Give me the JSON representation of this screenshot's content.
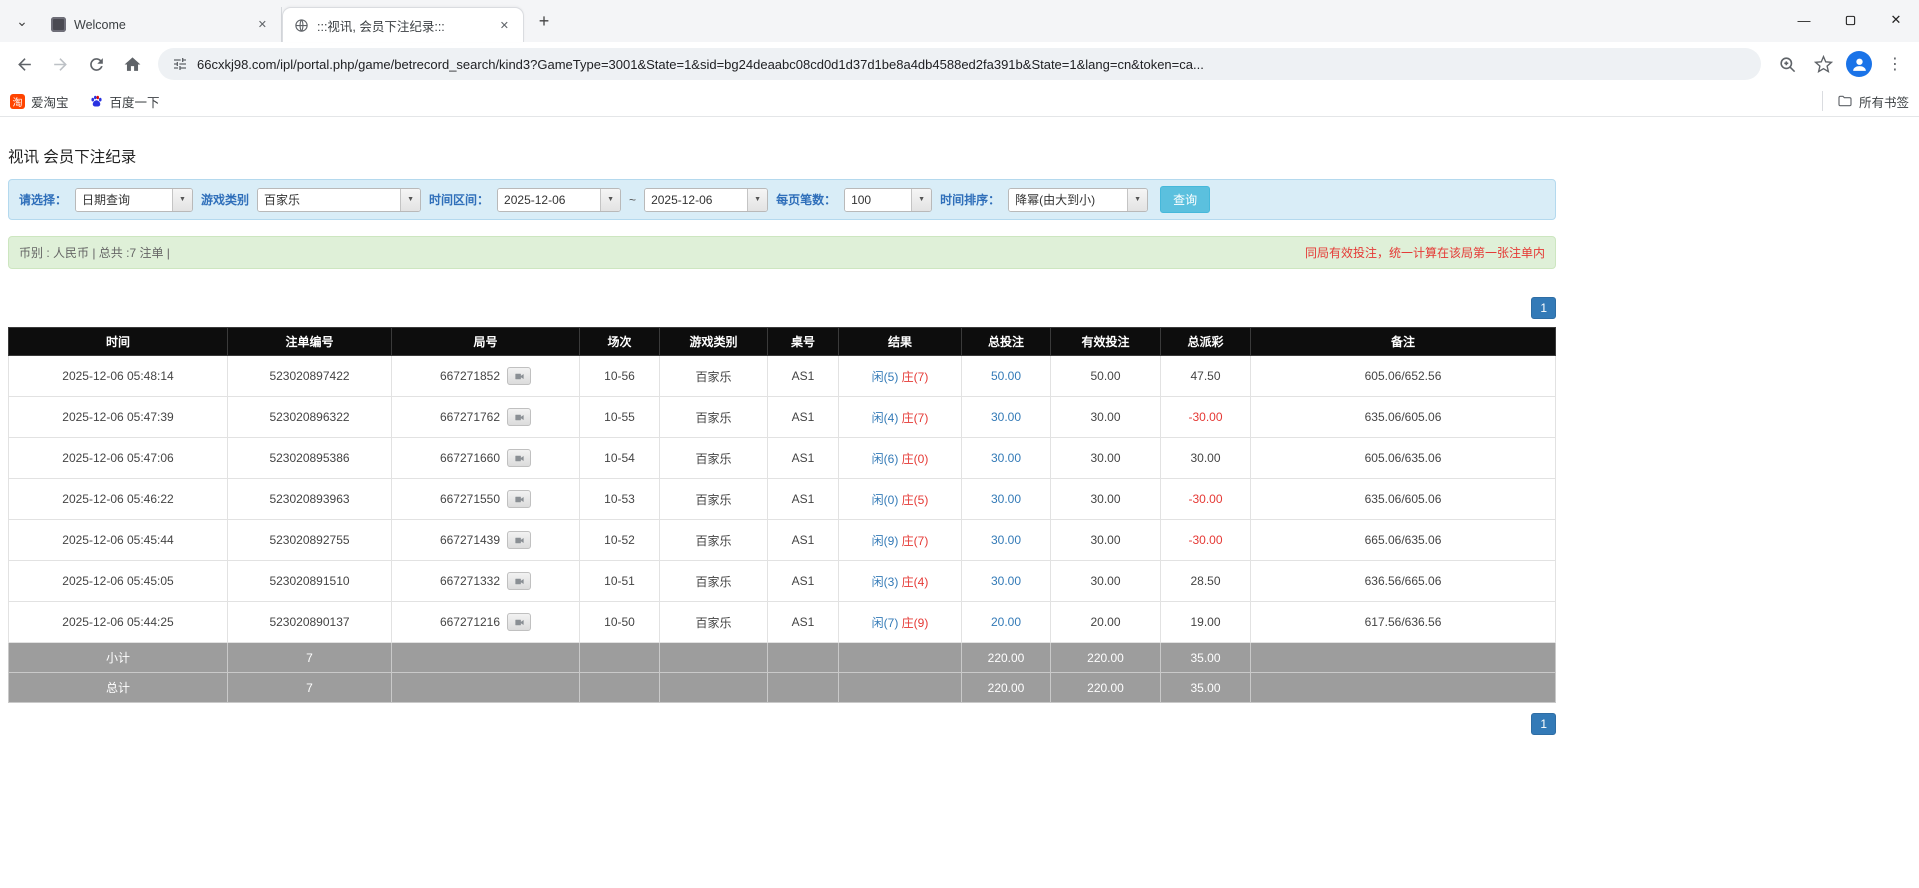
{
  "icons": {
    "tab_search": "⌄",
    "close": "✕",
    "new_tab": "+",
    "minimize": "—",
    "menu": "⋮",
    "dropdown": "▼"
  },
  "colors": {
    "accent_blue": "#337ab7",
    "search_button": "#5bc0de",
    "negative_red": "#e53935",
    "filter_bg": "#d9edf7",
    "summary_bg": "#dff0d8",
    "header_bg": "#0d0d0d",
    "total_row_bg": "#9d9d9d"
  },
  "browser": {
    "tabs": [
      {
        "title": "Welcome"
      },
      {
        "title": ":::视讯, 会员下注纪录:::"
      }
    ],
    "url": "66cxkj98.com/ipl/portal.php/game/betrecord_search/kind3?GameType=3001&State=1&sid=bg24deaabc08cd0d1d37d1be8a4db4588ed2fa391b&State=1&lang=cn&token=ca...",
    "bookmarks": [
      {
        "label": "爱淘宝",
        "icon_text": "淘"
      },
      {
        "label": "百度一下"
      }
    ],
    "all_bookmarks_label": "所有书签"
  },
  "page": {
    "title": "视讯 会员下注纪录",
    "filters": {
      "select_label": "请选择：",
      "select_value": "日期查询",
      "game_type_label": "游戏类别",
      "game_type_value": "百家乐",
      "date_range_label": "时间区间：",
      "date_from": "2025-12-06",
      "tilde": "~",
      "date_to": "2025-12-06",
      "page_size_label": "每页笔数：",
      "page_size_value": "100",
      "sort_label": "时间排序：",
      "sort_value": "降幂(由大到小)",
      "search_button": "查询"
    },
    "summary": {
      "left": "币别 : 人民币 | 总共 :7 注单 |",
      "right": "同局有效投注，统一计算在该局第一张注单内"
    },
    "pagination": "1",
    "table": {
      "headers": [
        "时间",
        "注单编号",
        "局号",
        "场次",
        "游戏类别",
        "桌号",
        "结果",
        "总投注",
        "有效投注",
        "总派彩",
        "备注"
      ],
      "rows": [
        {
          "time": "2025-12-06 05:48:14",
          "bet_id": "523020897422",
          "round_no": "667271852",
          "session": "10-56",
          "game": "百家乐",
          "table_no": "AS1",
          "player": "闲(5)",
          "banker": "庄(7)",
          "total_bet": "50.00",
          "valid_bet": "50.00",
          "payout": "47.50",
          "remark": "605.06/652.56"
        },
        {
          "time": "2025-12-06 05:47:39",
          "bet_id": "523020896322",
          "round_no": "667271762",
          "session": "10-55",
          "game": "百家乐",
          "table_no": "AS1",
          "player": "闲(4)",
          "banker": "庄(7)",
          "total_bet": "30.00",
          "valid_bet": "30.00",
          "payout": "-30.00",
          "remark": "635.06/605.06"
        },
        {
          "time": "2025-12-06 05:47:06",
          "bet_id": "523020895386",
          "round_no": "667271660",
          "session": "10-54",
          "game": "百家乐",
          "table_no": "AS1",
          "player": "闲(6)",
          "banker": "庄(0)",
          "total_bet": "30.00",
          "valid_bet": "30.00",
          "payout": "30.00",
          "remark": "605.06/635.06"
        },
        {
          "time": "2025-12-06 05:46:22",
          "bet_id": "523020893963",
          "round_no": "667271550",
          "session": "10-53",
          "game": "百家乐",
          "table_no": "AS1",
          "player": "闲(0)",
          "banker": "庄(5)",
          "total_bet": "30.00",
          "valid_bet": "30.00",
          "payout": "-30.00",
          "remark": "635.06/605.06"
        },
        {
          "time": "2025-12-06 05:45:44",
          "bet_id": "523020892755",
          "round_no": "667271439",
          "session": "10-52",
          "game": "百家乐",
          "table_no": "AS1",
          "player": "闲(9)",
          "banker": "庄(7)",
          "total_bet": "30.00",
          "valid_bet": "30.00",
          "payout": "-30.00",
          "remark": "665.06/635.06"
        },
        {
          "time": "2025-12-06 05:45:05",
          "bet_id": "523020891510",
          "round_no": "667271332",
          "session": "10-51",
          "game": "百家乐",
          "table_no": "AS1",
          "player": "闲(3)",
          "banker": "庄(4)",
          "total_bet": "30.00",
          "valid_bet": "30.00",
          "payout": "28.50",
          "remark": "636.56/665.06"
        },
        {
          "time": "2025-12-06 05:44:25",
          "bet_id": "523020890137",
          "round_no": "667271216",
          "session": "10-50",
          "game": "百家乐",
          "table_no": "AS1",
          "player": "闲(7)",
          "banker": "庄(9)",
          "total_bet": "20.00",
          "valid_bet": "20.00",
          "payout": "19.00",
          "remark": "617.56/636.56"
        }
      ],
      "subtotal": {
        "label": "小计",
        "count": "7",
        "total_bet": "220.00",
        "valid_bet": "220.00",
        "payout": "35.00"
      },
      "total": {
        "label": "总计",
        "count": "7",
        "total_bet": "220.00",
        "valid_bet": "220.00",
        "payout": "35.00"
      }
    }
  }
}
